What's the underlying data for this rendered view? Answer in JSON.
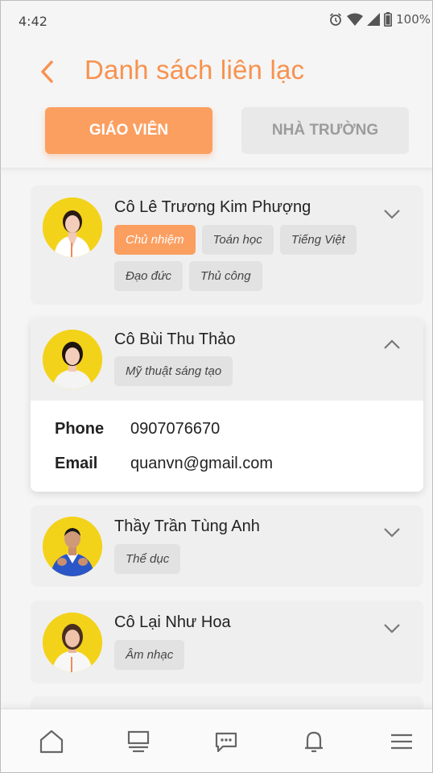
{
  "status_bar": {
    "time": "4:42",
    "battery": "100%",
    "icons": [
      "alarm-icon",
      "wifi-icon",
      "signal-icon",
      "battery-icon"
    ]
  },
  "header": {
    "title": "Danh sách liên lạc",
    "back_icon": "chevron-left-icon",
    "tabs": [
      {
        "label": "GIÁO VIÊN",
        "active": true
      },
      {
        "label": "NHÀ TRƯỜNG",
        "active": false
      }
    ]
  },
  "contacts": [
    {
      "name": "Cô Lê Trương Kim Phượng",
      "expanded": false,
      "tags": [
        {
          "label": "Chủ nhiệm",
          "highlight": true
        },
        {
          "label": "Toán học",
          "highlight": false
        },
        {
          "label": "Tiếng Việt",
          "highlight": false
        },
        {
          "label": "Đạo đức",
          "highlight": false
        },
        {
          "label": "Thủ công",
          "highlight": false
        }
      ]
    },
    {
      "name": "Cô Bùi Thu Thảo",
      "expanded": true,
      "tags": [
        {
          "label": "Mỹ thuật sáng tạo",
          "highlight": false
        }
      ],
      "phone_label": "Phone",
      "phone": "0907076670",
      "email_label": "Email",
      "email": "quanvn@gmail.com"
    },
    {
      "name": "Thầy Trần Tùng Anh",
      "expanded": false,
      "tags": [
        {
          "label": "Thể dục",
          "highlight": false
        }
      ]
    },
    {
      "name": "Cô Lại Như Hoa",
      "expanded": false,
      "tags": [
        {
          "label": "Âm nhạc",
          "highlight": false
        }
      ]
    }
  ],
  "bottom_nav": [
    "home-icon",
    "board-icon",
    "chat-icon",
    "bell-icon",
    "menu-icon"
  ],
  "colors": {
    "accent": "#f7924f",
    "tab_active": "#fb9f61",
    "avatar_bg": "#f3d21a"
  }
}
